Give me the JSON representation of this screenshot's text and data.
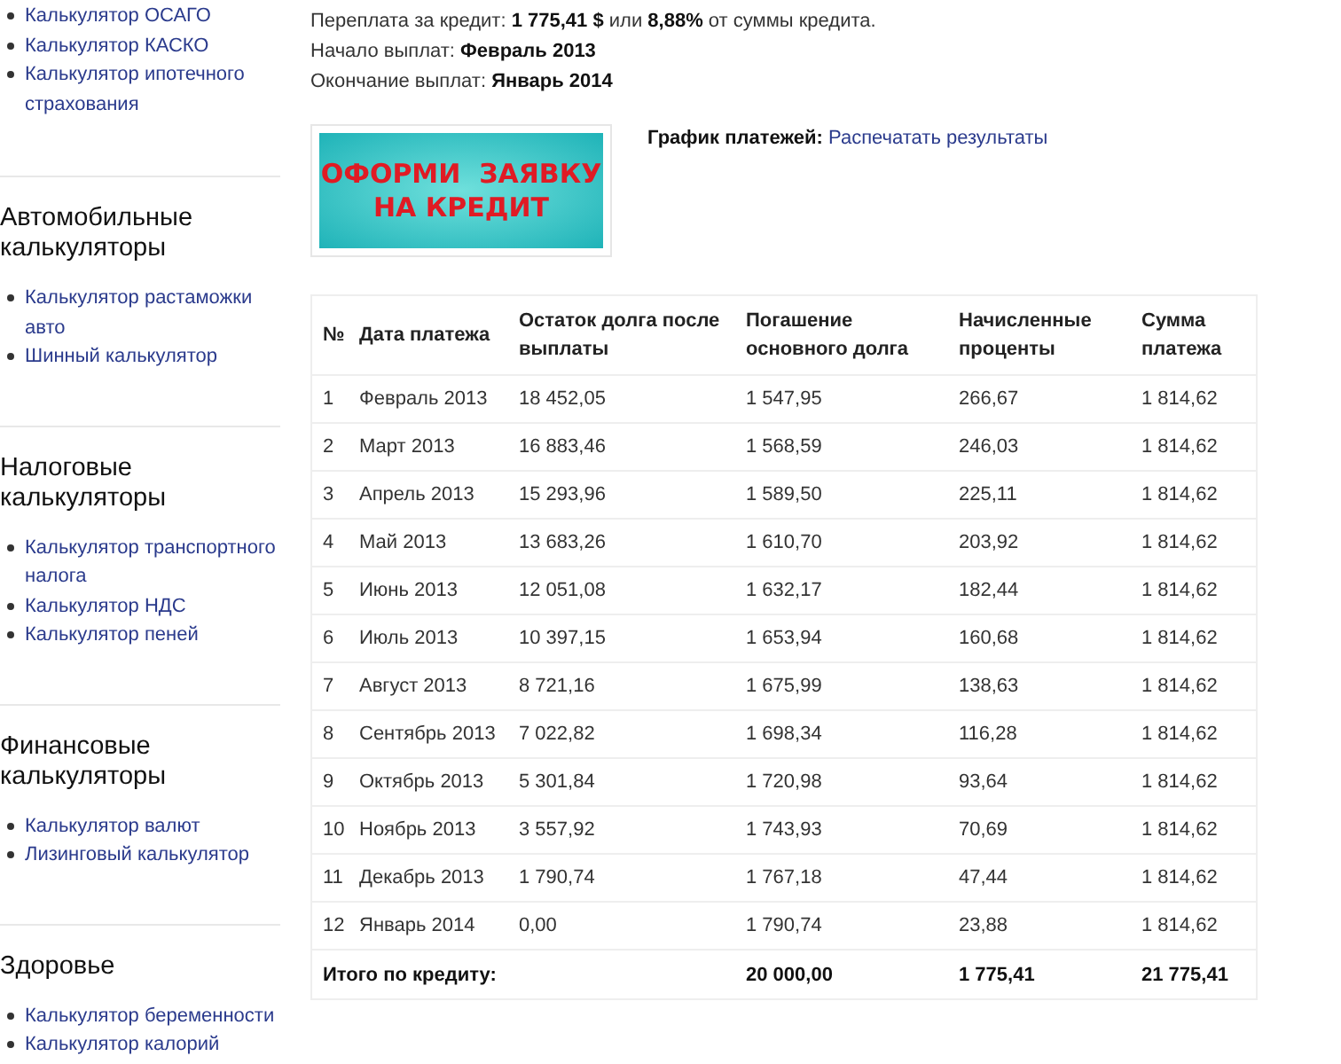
{
  "sidebar": {
    "sections": [
      {
        "items": [
          "Калькулятор ОСАГО",
          "Калькулятор КАСКО",
          "Калькулятор ипотечного страхования"
        ]
      },
      {
        "heading": "Автомобильные калькуляторы",
        "items": [
          "Калькулятор растаможки авто",
          "Шинный калькулятор"
        ]
      },
      {
        "heading": "Налоговые калькуляторы",
        "items": [
          "Калькулятор транспортного налога",
          "Калькулятор НДС",
          "Калькулятор пеней"
        ]
      },
      {
        "heading": "Финансовые калькуляторы",
        "items": [
          "Калькулятор валют",
          "Лизинговый калькулятор"
        ]
      },
      {
        "heading": "Здоровье",
        "items": [
          "Калькулятор беременности",
          "Калькулятор калорий"
        ]
      }
    ]
  },
  "summary": [
    "Переплата за кредит: **1 775,41 $** или **8,88%** от суммы кредита.",
    "Начало выплат: **Февраль 2013**",
    "Окончание выплат: **Январь 2014**"
  ],
  "banner": {
    "lines": [
      "ОФОРМИ  ЗАЯВКУ",
      "НА КРЕДИТ"
    ]
  },
  "schedule": {
    "label": "График платежей:",
    "link": "Распечатать результаты"
  },
  "table": {
    "columns": [
      "№",
      "Дата платежа",
      "Остаток долга после выплаты",
      "Погашение основного долга",
      "Начисленные проценты",
      "Сумма платежа"
    ],
    "rows": [
      [
        "1",
        "Февраль 2013",
        "18 452,05",
        "1 547,95",
        "266,67",
        "1 814,62"
      ],
      [
        "2",
        "Март 2013",
        "16 883,46",
        "1 568,59",
        "246,03",
        "1 814,62"
      ],
      [
        "3",
        "Апрель 2013",
        "15 293,96",
        "1 589,50",
        "225,11",
        "1 814,62"
      ],
      [
        "4",
        "Май 2013",
        "13 683,26",
        "1 610,70",
        "203,92",
        "1 814,62"
      ],
      [
        "5",
        "Июнь 2013",
        "12 051,08",
        "1 632,17",
        "182,44",
        "1 814,62"
      ],
      [
        "6",
        "Июль 2013",
        "10 397,15",
        "1 653,94",
        "160,68",
        "1 814,62"
      ],
      [
        "7",
        "Август 2013",
        "8 721,16",
        "1 675,99",
        "138,63",
        "1 814,62"
      ],
      [
        "8",
        "Сентябрь 2013",
        "7 022,82",
        "1 698,34",
        "116,28",
        "1 814,62"
      ],
      [
        "9",
        "Октябрь 2013",
        "5 301,84",
        "1 720,98",
        "93,64",
        "1 814,62"
      ],
      [
        "10",
        "Ноябрь 2013",
        "3 557,92",
        "1 743,93",
        "70,69",
        "1 814,62"
      ],
      [
        "11",
        "Декабрь 2013",
        "1 790,74",
        "1 767,18",
        "47,44",
        "1 814,62"
      ],
      [
        "12",
        "Январь 2014",
        "0,00",
        "1 790,74",
        "23,88",
        "1 814,62"
      ]
    ],
    "total": {
      "label": "Итого по кредиту:",
      "values": [
        "20 000,00",
        "1 775,41",
        "21 775,41"
      ]
    }
  }
}
